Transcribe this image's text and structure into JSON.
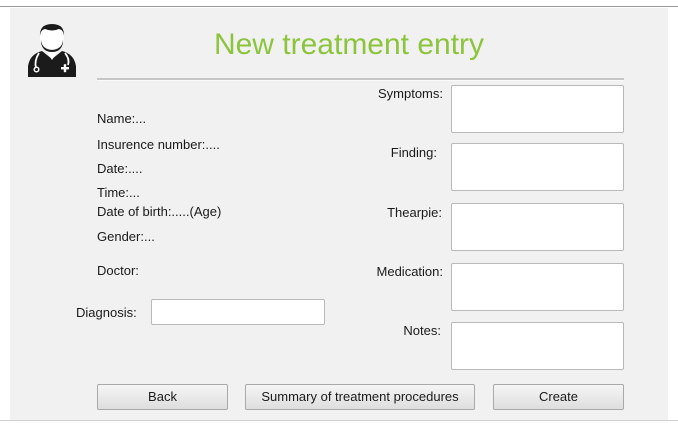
{
  "header": {
    "title": "New treatment entry",
    "avatar_icon": "doctor-avatar-icon",
    "title_color": "#8cc43c"
  },
  "patient_info": {
    "name": "Name:...",
    "insurance_number": "Insurence number:....",
    "date": "Date:....",
    "time": "Time:...",
    "date_of_birth": "Date of birth:.....(Age)",
    "gender": "Gender:...",
    "doctor": "Doctor:"
  },
  "diagnosis": {
    "label": "Diagnosis:",
    "value": ""
  },
  "fields": {
    "symptoms": {
      "label": "Symptoms:",
      "value": ""
    },
    "finding": {
      "label": "Finding:",
      "value": ""
    },
    "therapy": {
      "label": "Thearpie:",
      "value": ""
    },
    "medication": {
      "label": "Medication:",
      "value": ""
    },
    "notes": {
      "label": "Notes:",
      "value": ""
    }
  },
  "buttons": {
    "back": "Back",
    "summary": "Summary of treatment procedures",
    "create": "Create"
  }
}
